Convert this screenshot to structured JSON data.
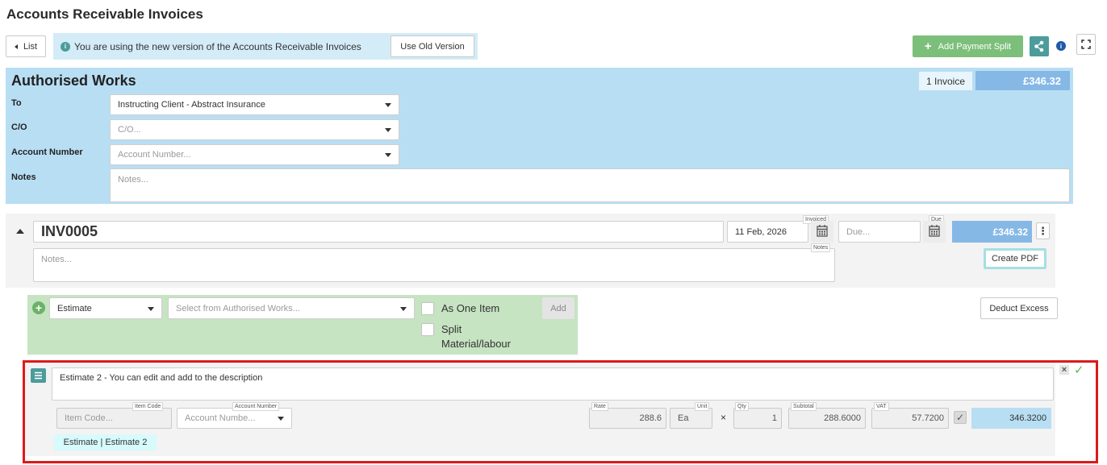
{
  "page": {
    "title": "Accounts Receivable Invoices"
  },
  "toolbar": {
    "list_label": "List",
    "info_text": "You are using the new version of the Accounts Receivable Invoices",
    "use_old_version_label": "Use Old Version",
    "add_payment_split_label": "Add Payment Split"
  },
  "authorised_works": {
    "title": "Authorised Works",
    "invoice_count": "1 Invoice",
    "total": "£346.32",
    "to_label": "To",
    "to_value": "Instructing Client - Abstract Insurance",
    "co_label": "C/O",
    "co_placeholder": "C/O...",
    "account_number_label": "Account Number",
    "account_number_placeholder": "Account Number...",
    "notes_label": "Notes",
    "notes_placeholder": "Notes..."
  },
  "invoice": {
    "number": "INV0005",
    "invoiced_tag": "Invoiced",
    "invoiced_date": "11 Feb, 2026",
    "due_tag": "Due",
    "due_placeholder": "Due...",
    "amount": "£346.32",
    "notes_placeholder": "Notes...",
    "notes_tag": "Notes",
    "create_pdf_label": "Create PDF"
  },
  "add_line": {
    "type_value": "Estimate",
    "source_placeholder": "Select from Authorised Works...",
    "as_one_item_label": "As One Item",
    "split_label": "Split Material/labour",
    "add_label": "Add",
    "deduct_excess_label": "Deduct Excess"
  },
  "line_item": {
    "description": "Estimate 2 - You can edit and add to the description",
    "item_code_tag": "Item Code",
    "item_code_placeholder": "Item Code...",
    "account_number_tag": "Account Number",
    "account_number_placeholder": "Account Numbe...",
    "rate_tag": "Rate",
    "rate": "288.6",
    "unit_tag": "Unit",
    "unit": "Ea",
    "times": "×",
    "qty_tag": "Qty",
    "qty": "1",
    "subtotal_tag": "Subtotal",
    "subtotal": "288.6000",
    "vat_tag": "VAT",
    "vat": "57.7200",
    "total": "346.3200",
    "source_badge": "Estimate | Estimate 2"
  },
  "colors": {
    "panel_blue": "#b8def3",
    "total_blue": "#86b8e6",
    "green_panel": "#c6e3c2",
    "green_button": "#7cbf7a",
    "teal": "#4c9c9b",
    "highlight_red": "#dd1a1a",
    "badge_cyan": "#d7fafd"
  }
}
